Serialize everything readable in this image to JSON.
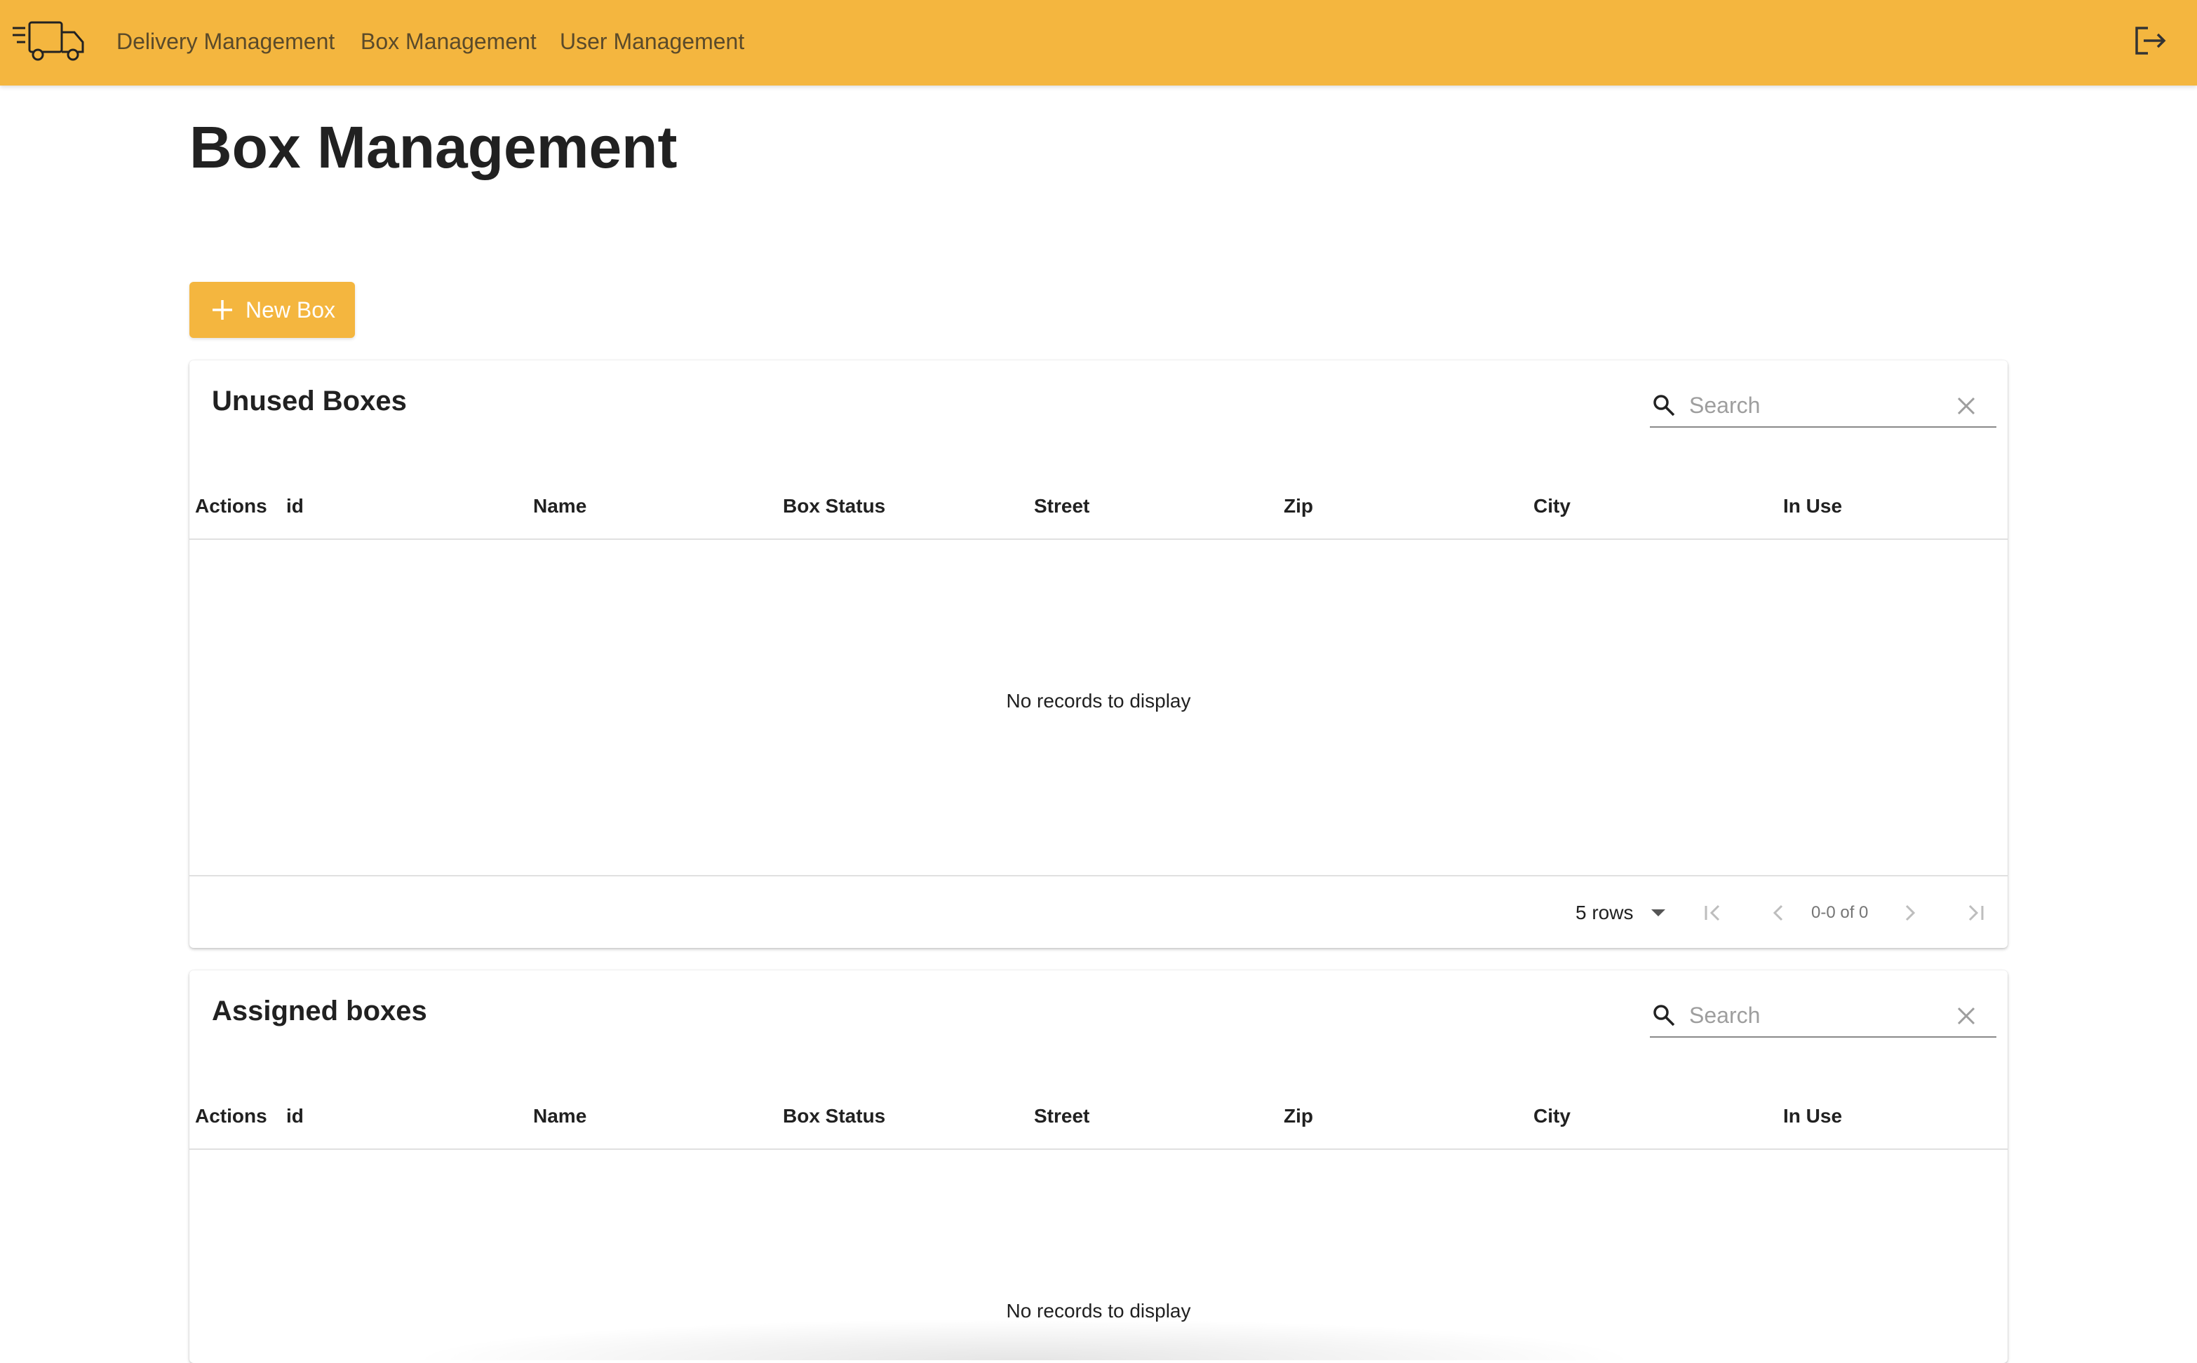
{
  "nav": {
    "logo_icon": "delivery-truck-icon",
    "items": [
      "Delivery Management",
      "Box Management",
      "User Management"
    ],
    "logout_icon": "logout-icon"
  },
  "colors": {
    "primary": "#f4b63f",
    "nav_text": "#5a4a2a"
  },
  "page": {
    "title": "Box Management"
  },
  "new_box_button": {
    "label": "New Box",
    "icon": "plus-icon"
  },
  "columns": [
    "Actions",
    "id",
    "Name",
    "Box Status",
    "Street",
    "Zip",
    "City",
    "In Use"
  ],
  "tables": [
    {
      "title": "Unused Boxes",
      "search_placeholder": "Search",
      "empty_message": "No records to display",
      "rows_per_page": "5 rows",
      "page_info": "0-0 of 0"
    },
    {
      "title": "Assigned boxes",
      "search_placeholder": "Search",
      "empty_message": "No records to display"
    }
  ]
}
